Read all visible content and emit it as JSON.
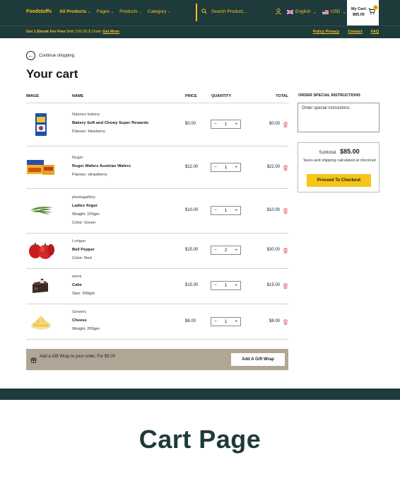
{
  "header": {
    "logo": "Foodstuffs",
    "nav": [
      {
        "label": "All Products",
        "active": true
      },
      {
        "label": "Pages",
        "active": false
      },
      {
        "label": "Products",
        "active": false
      },
      {
        "label": "Category",
        "active": false
      }
    ],
    "search_placeholder": "Search Product...",
    "language": "English",
    "currency": "USD",
    "cart_label": "My Cart:",
    "cart_amount": "$85.00",
    "cart_count": "6"
  },
  "promo": {
    "bold": "Get 1 Ebook For Free",
    "text": " With 200.00 $ Order",
    "link": "Get More",
    "links": [
      "Policy Privacy",
      "Contact",
      "FAQ"
    ]
  },
  "page": {
    "continue_label": "Continue shopping",
    "title": "Your cart"
  },
  "table": {
    "headers": {
      "image": "IMAGE",
      "name": "NAME",
      "price": "PRICE",
      "quantity": "QUANTITY",
      "total": "TOTAL"
    },
    "rows": [
      {
        "vendor": "Natores bakery",
        "name": "Bakery Soft and Chewy Super Rewards",
        "opt1": "Flavour: blueberry",
        "opt2": "",
        "price": "$0.00",
        "qty": "1",
        "total": "$0.00",
        "image": "blue-box"
      },
      {
        "vendor": "Ruger",
        "name": "Ruger Wafers Austrian Wafers",
        "opt1": "Flavour: strawberry",
        "opt2": "",
        "price": "$22.00",
        "qty": "1",
        "total": "$22.00",
        "image": "wafers"
      },
      {
        "vendor": "plantagallery",
        "name": "Ladies finger",
        "opt1": "Weight: 100gm",
        "opt2": "Color: Green",
        "price": "$10.00",
        "qty": "1",
        "total": "$10.00",
        "image": "okra"
      },
      {
        "vendor": "Lorigun",
        "name": "Bell Pepper",
        "opt1": "Color: Red",
        "opt2": "",
        "price": "$15.00",
        "qty": "2",
        "total": "$30.00",
        "image": "pepper"
      },
      {
        "vendor": "winni",
        "name": "Cake",
        "opt1": "Size: 500gm",
        "opt2": "",
        "price": "$15.00",
        "qty": "1",
        "total": "$15.00",
        "image": "cake"
      },
      {
        "vendor": "Generic",
        "name": "Cheese",
        "opt1": "Weight: 200gm",
        "opt2": "",
        "price": "$8.00",
        "qty": "1",
        "total": "$8.00",
        "image": "cheese"
      }
    ]
  },
  "gift": {
    "text": "Add a Gift Wrap to your order, For $5.00",
    "button": "Add A Gift Wrap"
  },
  "sidebar": {
    "instructions_title": "ORDER SPECIAL INSTRUCTIONS",
    "instructions_placeholder": "Order special instructions",
    "subtotal_label": "Subtotal",
    "subtotal_value": "$85.00",
    "shipping_note": "Taxes and shipping calculated at checkout",
    "checkout_button": "Proceed To Checkout"
  },
  "caption": "Cart Page",
  "colors": {
    "brand_dark": "#1f3a3a",
    "accent": "#f5c518",
    "gift_bg": "#b0a696",
    "trash": "#e05050"
  }
}
